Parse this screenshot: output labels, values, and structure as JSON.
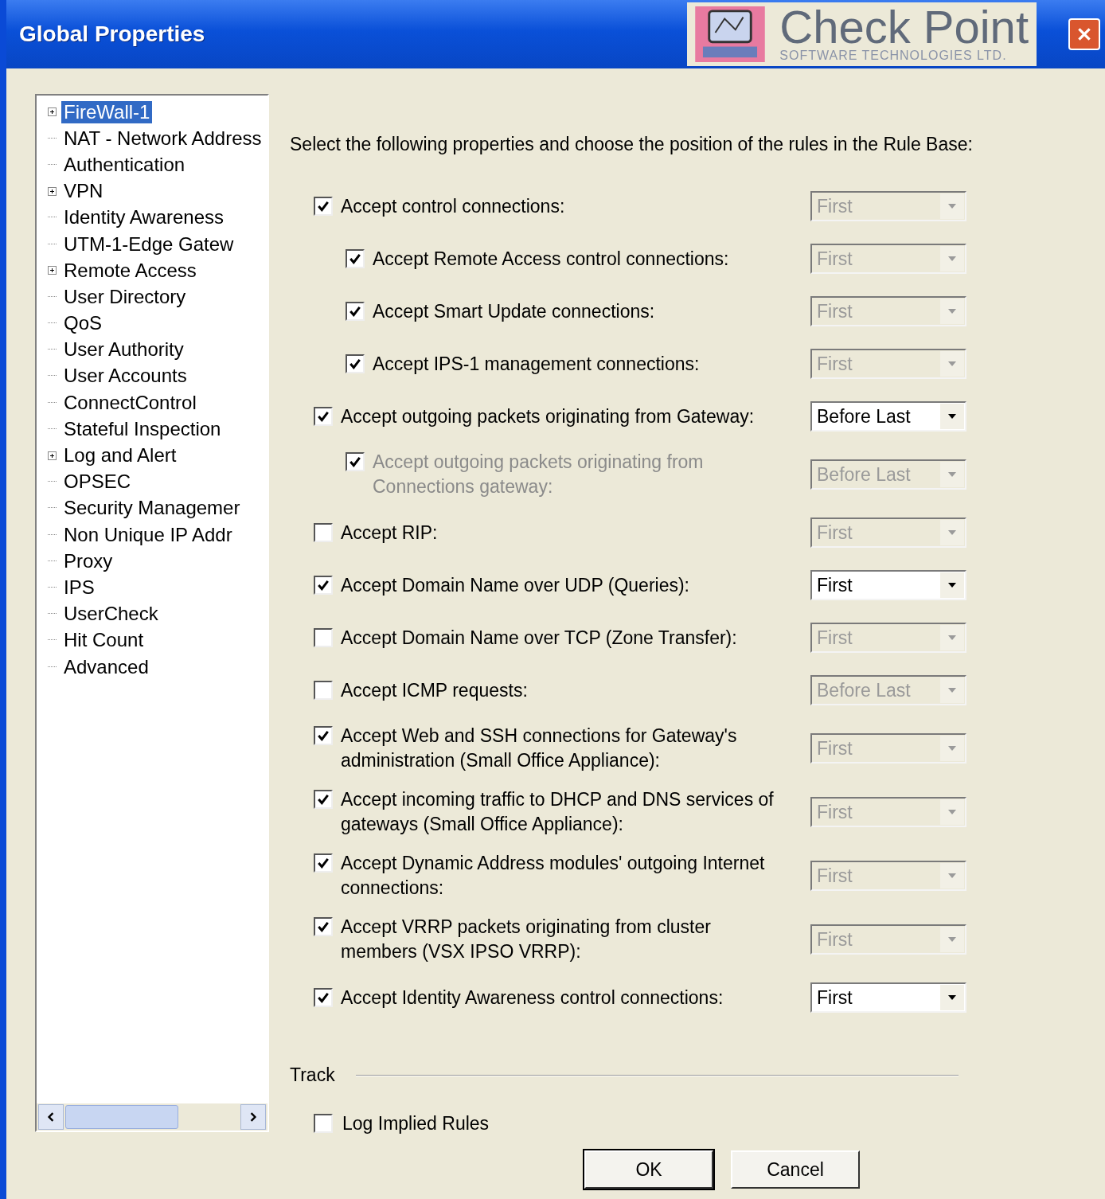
{
  "window": {
    "title": "Global Properties",
    "logo": {
      "name": "Check Point",
      "tagline": "SOFTWARE TECHNOLOGIES LTD."
    }
  },
  "sidebar": {
    "items": [
      {
        "label": "FireWall-1",
        "kind": "folder",
        "selected": true
      },
      {
        "label": "NAT - Network Address",
        "kind": "leaf",
        "selected": false
      },
      {
        "label": "Authentication",
        "kind": "leaf",
        "selected": false
      },
      {
        "label": "VPN",
        "kind": "folder",
        "selected": false
      },
      {
        "label": "Identity Awareness",
        "kind": "leaf",
        "selected": false
      },
      {
        "label": "UTM-1-Edge Gatew",
        "kind": "leaf",
        "selected": false
      },
      {
        "label": "Remote Access",
        "kind": "folder",
        "selected": false
      },
      {
        "label": "User Directory",
        "kind": "leaf",
        "selected": false
      },
      {
        "label": "QoS",
        "kind": "leaf",
        "selected": false
      },
      {
        "label": "User Authority",
        "kind": "leaf",
        "selected": false
      },
      {
        "label": "User Accounts",
        "kind": "leaf",
        "selected": false
      },
      {
        "label": "ConnectControl",
        "kind": "leaf",
        "selected": false
      },
      {
        "label": "Stateful Inspection",
        "kind": "leaf",
        "selected": false
      },
      {
        "label": "Log and Alert",
        "kind": "folder",
        "selected": false
      },
      {
        "label": "OPSEC",
        "kind": "leaf",
        "selected": false
      },
      {
        "label": "Security Managemer",
        "kind": "leaf",
        "selected": false
      },
      {
        "label": "Non Unique IP Addr",
        "kind": "leaf",
        "selected": false
      },
      {
        "label": "Proxy",
        "kind": "leaf",
        "selected": false
      },
      {
        "label": "IPS",
        "kind": "leaf",
        "selected": false
      },
      {
        "label": "UserCheck",
        "kind": "leaf",
        "selected": false
      },
      {
        "label": "Hit Count",
        "kind": "leaf",
        "selected": false
      },
      {
        "label": "Advanced",
        "kind": "leaf",
        "selected": false
      }
    ]
  },
  "intro": "Select the following properties and choose the position of the rules in the Rule Base:",
  "rules": [
    {
      "label": "Accept control connections:",
      "checked": true,
      "disabled": false,
      "position": "First",
      "position_disabled": true,
      "children": [
        {
          "label": "Accept Remote Access control connections:",
          "checked": true,
          "disabled": false,
          "position": "First",
          "position_disabled": true
        },
        {
          "label": "Accept Smart Update connections:",
          "checked": true,
          "disabled": false,
          "position": "First",
          "position_disabled": true
        },
        {
          "label": "Accept IPS-1 management connections:",
          "checked": true,
          "disabled": false,
          "position": "First",
          "position_disabled": true
        }
      ]
    },
    {
      "label": "Accept outgoing packets originating from Gateway:",
      "checked": true,
      "disabled": false,
      "position": "Before Last",
      "position_disabled": false,
      "children": [
        {
          "label": "Accept outgoing packets originating from Connections gateway:",
          "checked": true,
          "disabled": true,
          "position": "Before Last",
          "position_disabled": true
        }
      ]
    },
    {
      "label": "Accept RIP:",
      "checked": false,
      "disabled": false,
      "position": "First",
      "position_disabled": true
    },
    {
      "label": "Accept Domain Name over UDP (Queries):",
      "checked": true,
      "disabled": false,
      "position": "First",
      "position_disabled": false
    },
    {
      "label": "Accept Domain Name over TCP (Zone Transfer):",
      "checked": false,
      "disabled": false,
      "position": "First",
      "position_disabled": true
    },
    {
      "label": "Accept ICMP requests:",
      "checked": false,
      "disabled": false,
      "position": "Before Last",
      "position_disabled": true
    },
    {
      "label": "Accept Web and SSH connections for Gateway's administration (Small Office Appliance):",
      "checked": true,
      "disabled": false,
      "position": "First",
      "position_disabled": true
    },
    {
      "label": "Accept incoming traffic to DHCP and DNS services of gateways (Small Office Appliance):",
      "checked": true,
      "disabled": false,
      "position": "First",
      "position_disabled": true
    },
    {
      "label": "Accept Dynamic Address modules' outgoing Internet connections:",
      "checked": true,
      "disabled": false,
      "position": "First",
      "position_disabled": true
    },
    {
      "label": "Accept VRRP packets originating from cluster members (VSX IPSO VRRP):",
      "checked": true,
      "disabled": false,
      "position": "First",
      "position_disabled": true
    },
    {
      "label": "Accept Identity Awareness control connections:",
      "checked": true,
      "disabled": false,
      "position": "First",
      "position_disabled": false
    }
  ],
  "track": {
    "title": "Track",
    "options": [
      {
        "label": "Log Implied Rules",
        "checked": false
      }
    ]
  },
  "buttons": [
    "OK",
    "Cancel"
  ]
}
